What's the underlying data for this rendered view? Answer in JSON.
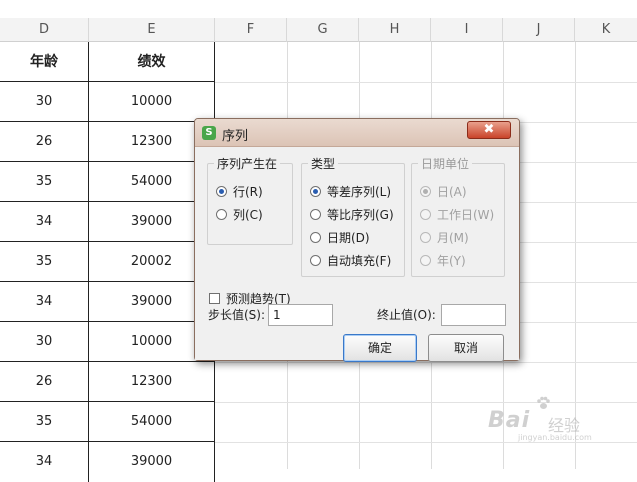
{
  "sheet": {
    "columns": [
      "D",
      "E",
      "F",
      "G",
      "H",
      "I",
      "J",
      "K"
    ],
    "header": {
      "d": "年龄",
      "e": "绩效"
    },
    "rows": [
      {
        "d": "30",
        "e": "10000"
      },
      {
        "d": "26",
        "e": "12300"
      },
      {
        "d": "35",
        "e": "54000"
      },
      {
        "d": "34",
        "e": "39000"
      },
      {
        "d": "35",
        "e": "20002"
      },
      {
        "d": "34",
        "e": "39000"
      },
      {
        "d": "30",
        "e": "10000"
      },
      {
        "d": "26",
        "e": "12300"
      },
      {
        "d": "35",
        "e": "54000"
      },
      {
        "d": "34",
        "e": "39000"
      }
    ]
  },
  "dialog": {
    "title": "序列",
    "icon_letter": "S",
    "close_glyph": "✖",
    "series_in": {
      "title": "序列产生在",
      "options": [
        {
          "label": "行(R)",
          "checked": true
        },
        {
          "label": "列(C)",
          "checked": false
        }
      ]
    },
    "type": {
      "title": "类型",
      "options": [
        {
          "label": "等差序列(L)",
          "checked": true
        },
        {
          "label": "等比序列(G)",
          "checked": false
        },
        {
          "label": "日期(D)",
          "checked": false
        },
        {
          "label": "自动填充(F)",
          "checked": false
        }
      ]
    },
    "date_unit": {
      "title": "日期单位",
      "options": [
        {
          "label": "日(A)",
          "checked": true
        },
        {
          "label": "工作日(W)",
          "checked": false
        },
        {
          "label": "月(M)",
          "checked": false
        },
        {
          "label": "年(Y)",
          "checked": false
        }
      ]
    },
    "trend_label": "预测趋势(T)",
    "step_label": "步长值(S):",
    "step_value": "1",
    "stop_label": "终止值(O):",
    "stop_value": "",
    "ok_label": "确定",
    "cancel_label": "取消"
  },
  "watermark": {
    "brand": "Bai",
    "brand_tail": "经验",
    "url": "jingyan.baidu.com"
  }
}
